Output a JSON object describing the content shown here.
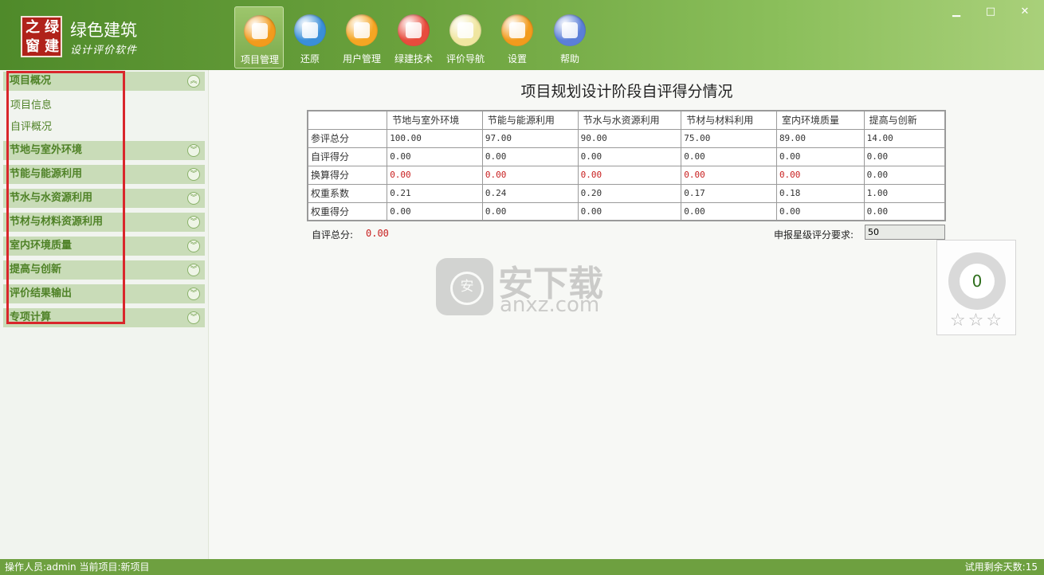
{
  "app": {
    "logo_chars": [
      "之",
      "绿",
      "窗",
      "建"
    ],
    "title": "绿色建筑",
    "subtitle": "设计评价软件"
  },
  "toolbar": [
    {
      "label": "项目管理",
      "icon": "folder-icon",
      "color": "#f29b1d"
    },
    {
      "label": "还原",
      "icon": "restore-icon",
      "color": "#3a8fd9"
    },
    {
      "label": "用户管理",
      "icon": "user-icon",
      "color": "#f5a623"
    },
    {
      "label": "绿建技术",
      "icon": "network-icon",
      "color": "#e84c3d"
    },
    {
      "label": "评价导航",
      "icon": "book-icon",
      "color": "#f0e6a0"
    },
    {
      "label": "设置",
      "icon": "gear-icon",
      "color": "#f29b1d"
    },
    {
      "label": "帮助",
      "icon": "help-icon",
      "color": "#5b7fd8"
    }
  ],
  "window_controls": {
    "minimize": "▁",
    "maximize": "□",
    "close": "✕"
  },
  "sidebar": {
    "sections": [
      {
        "label": "项目概况",
        "expanded": true,
        "items": [
          "项目信息",
          "自评概况"
        ]
      },
      {
        "label": "节地与室外环境",
        "expanded": false
      },
      {
        "label": "节能与能源利用",
        "expanded": false
      },
      {
        "label": "节水与水资源利用",
        "expanded": false
      },
      {
        "label": "节材与材料资源利用",
        "expanded": false
      },
      {
        "label": "室内环境质量",
        "expanded": false
      },
      {
        "label": "提高与创新",
        "expanded": false
      },
      {
        "label": "评价结果输出",
        "expanded": false
      },
      {
        "label": "专项计算",
        "expanded": false
      }
    ],
    "chevron_up": "︽",
    "chevron_down": "︾"
  },
  "main": {
    "title": "项目规划设计阶段自评得分情况",
    "table": {
      "columns": [
        "",
        "节地与室外环境",
        "节能与能源利用",
        "节水与水资源利用",
        "节材与材料利用",
        "室内环境质量",
        "提高与创新"
      ],
      "rows": [
        {
          "label": "参评总分",
          "values": [
            "100.00",
            "97.00",
            "90.00",
            "75.00",
            "89.00",
            "14.00"
          ],
          "red": [
            false,
            false,
            false,
            false,
            false,
            false
          ]
        },
        {
          "label": "自评得分",
          "values": [
            "0.00",
            "0.00",
            "0.00",
            "0.00",
            "0.00",
            "0.00"
          ],
          "red": [
            false,
            false,
            false,
            false,
            false,
            false
          ]
        },
        {
          "label": "换算得分",
          "values": [
            "0.00",
            "0.00",
            "0.00",
            "0.00",
            "0.00",
            "0.00"
          ],
          "red": [
            true,
            true,
            true,
            true,
            true,
            false
          ]
        },
        {
          "label": "权重系数",
          "values": [
            "0.21",
            "0.24",
            "0.20",
            "0.17",
            "0.18",
            "1.00"
          ],
          "red": [
            false,
            false,
            false,
            false,
            false,
            false
          ]
        },
        {
          "label": "权重得分",
          "values": [
            "0.00",
            "0.00",
            "0.00",
            "0.00",
            "0.00",
            "0.00"
          ],
          "red": [
            false,
            false,
            false,
            false,
            false,
            false
          ]
        }
      ]
    },
    "total_label": "自评总分:",
    "total_value": "0.00",
    "star_requirement_label": "申报星级评分要求:",
    "star_requirement_value": "50",
    "score_widget": {
      "value": "0",
      "stars": "☆☆☆"
    },
    "watermark": {
      "text": "安下载",
      "url": "anxz.com"
    }
  },
  "status": {
    "left": "操作人员:admin  当前项目:新项目",
    "right": "试用剩余天数:15"
  },
  "colors": {
    "accent": "#6ea040",
    "red_value": "#c81e1e",
    "section_bg": "#c9dcb8"
  }
}
